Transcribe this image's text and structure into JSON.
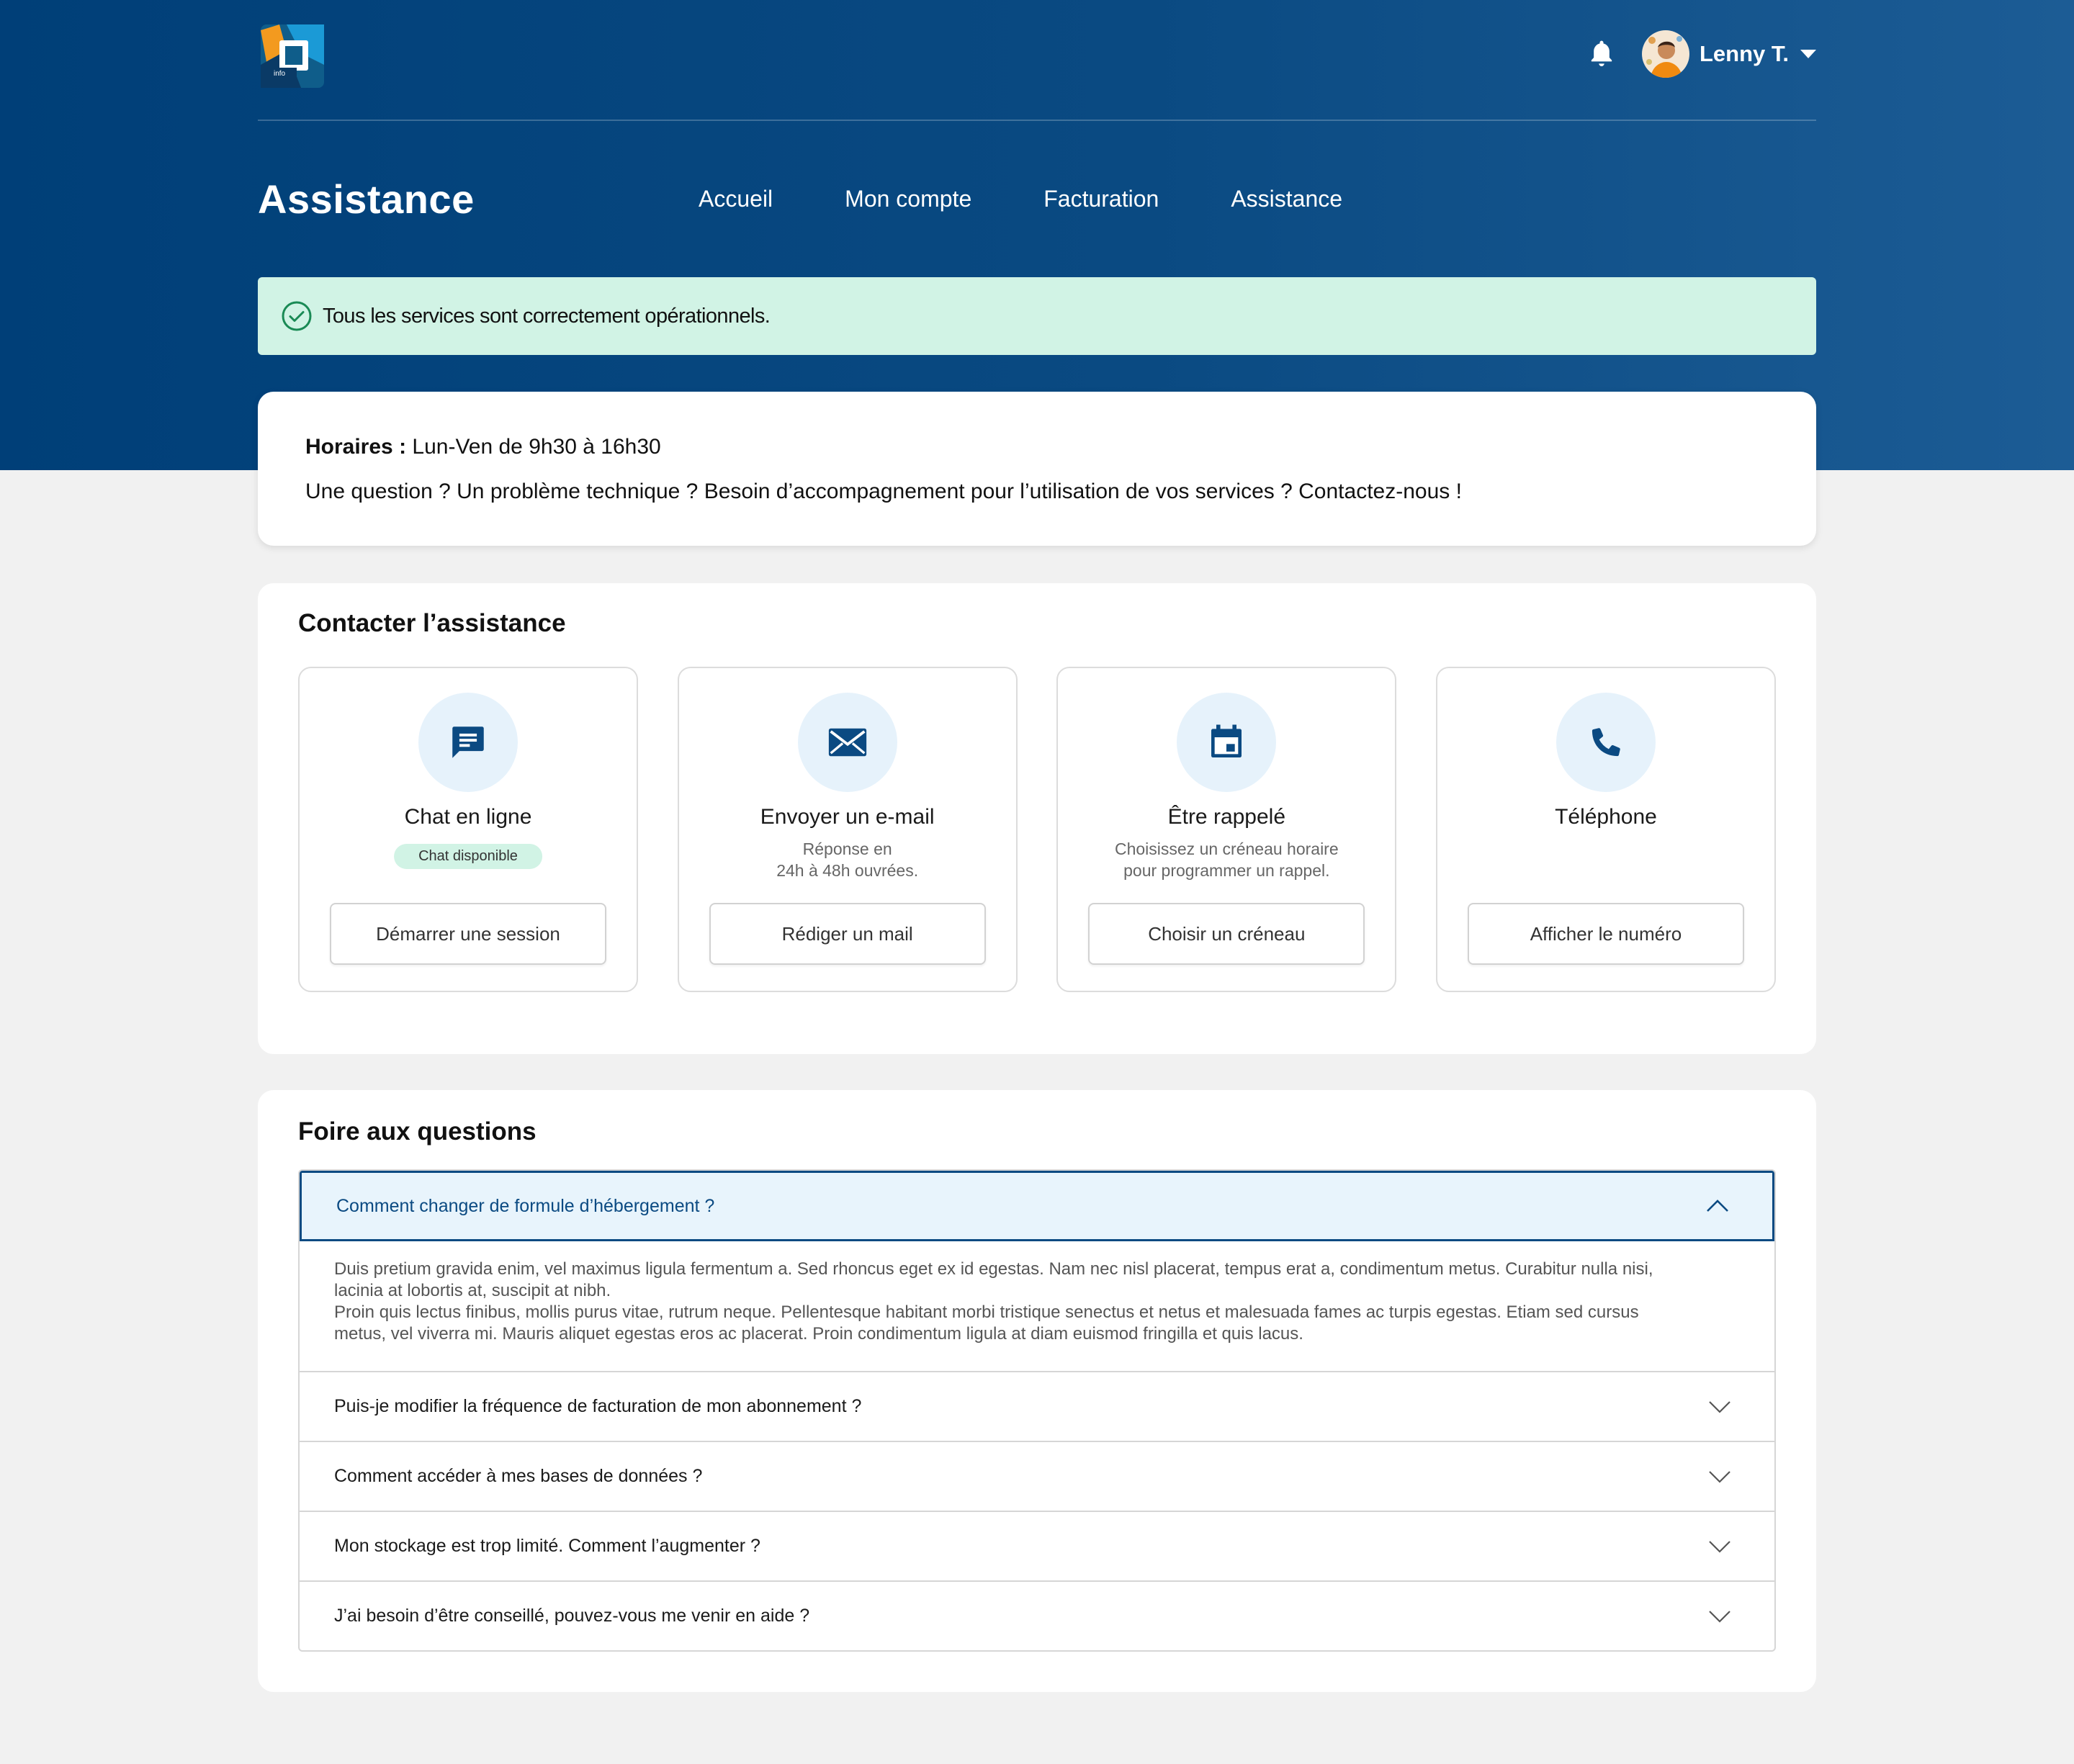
{
  "header": {
    "logo_text": "info",
    "user_name": "Lenny T."
  },
  "nav": {
    "page_title": "Assistance",
    "items": [
      "Accueil",
      "Mon compte",
      "Facturation",
      "Assistance"
    ]
  },
  "status": {
    "text": "Tous les services sont correctement opérationnels."
  },
  "info": {
    "hours_label": "Horaires :",
    "hours_value": " Lun-Ven de 9h30 à 16h30",
    "message": "Une question ? Un problème technique ? Besoin d’accompagnement pour l’utilisation de vos services ? Contactez-nous !"
  },
  "contact": {
    "title": "Contacter l’assistance",
    "cards": [
      {
        "icon": "chat-icon",
        "title": "Chat en ligne",
        "badge": "Chat disponible",
        "desc": "",
        "button": "Démarrer une session"
      },
      {
        "icon": "mail-icon",
        "title": "Envoyer un e-mail",
        "badge": "",
        "desc": "Réponse en\n24h à 48h ouvrées.",
        "button": "Rédiger un mail"
      },
      {
        "icon": "calendar-icon",
        "title": "Être rappelé",
        "badge": "",
        "desc": "Choisissez un créneau horaire\npour programmer un rappel.",
        "button": "Choisir un créneau"
      },
      {
        "icon": "phone-icon",
        "title": "Téléphone",
        "badge": "",
        "desc": "",
        "button": "Afficher le numéro"
      }
    ]
  },
  "faq": {
    "title": "Foire aux questions",
    "items": [
      {
        "question": "Comment changer de formule d’hébergement ?",
        "open": true,
        "answer_p1": "Duis pretium gravida enim, vel maximus ligula fermentum a. Sed rhoncus eget ex id egestas. Nam nec nisl placerat, tempus erat a, condimentum metus. Curabitur nulla nisi, lacinia at lobortis at, suscipit at nibh.",
        "answer_p2": "Proin quis lectus finibus, mollis purus vitae, rutrum neque. Pellentesque habitant morbi tristique senectus et netus et malesuada fames ac turpis egestas. Etiam sed cursus metus, vel viverra mi. Mauris aliquet egestas eros ac placerat. Proin condimentum ligula at diam euismod fringilla et quis lacus."
      },
      {
        "question": "Puis-je modifier la fréquence de facturation de mon abonnement ?",
        "open": false
      },
      {
        "question": "Comment accéder à mes bases de données ?",
        "open": false
      },
      {
        "question": "Mon stockage est trop limité. Comment l’augmenter ?",
        "open": false
      },
      {
        "question": "J’ai besoin d’être conseillé, pouvez-vous me venir en aide ?",
        "open": false
      }
    ]
  },
  "colors": {
    "primary": "#0b4a82",
    "hero_dark": "#003f78",
    "success_bg": "#d1f3e5",
    "icon_circle": "#e6f2fb"
  }
}
